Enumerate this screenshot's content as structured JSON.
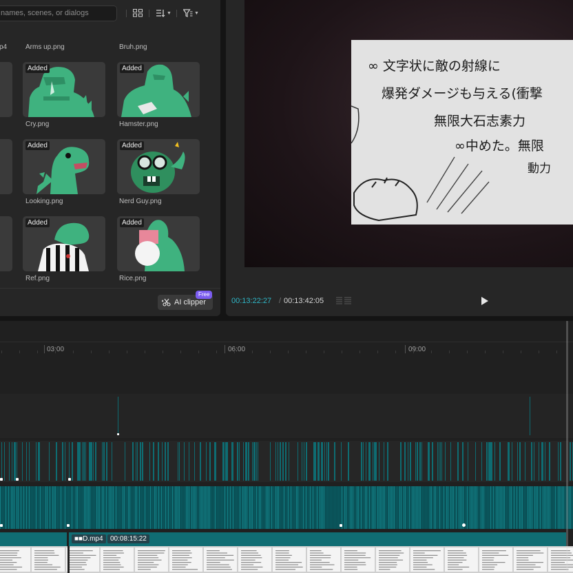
{
  "media": {
    "search_placeholder": "names, scenes, or dialogs",
    "added_label": "Added",
    "files": {
      "row0": [
        "p4",
        "Arms up.png",
        "Bruh.png"
      ],
      "row1": [
        "Cry.png",
        "Hamster.png"
      ],
      "row2": [
        "Looking.png",
        "Nerd Guy.png"
      ],
      "row3": [
        "Ref.png",
        "Rice.png"
      ]
    },
    "ai_clipper_label": "AI clipper",
    "free_label": "Free"
  },
  "player": {
    "current_time": "00:13:22:27",
    "separator": "/",
    "total_time": "00:13:42:05",
    "note_lines": [
      "∞ 文字状に敵の射線に",
      "爆発ダメージも与える(衝撃",
      "無限大石志素力",
      "∞中めた。無限",
      "動力"
    ]
  },
  "timeline": {
    "ruler_labels": [
      "03:00",
      "06:00",
      "09:00"
    ],
    "clip_name": "■■D.mp4",
    "clip_duration": "00:08:15:22"
  },
  "colors": {
    "accent_teal": "#2fb8c8",
    "track_teal": "#0e6c72",
    "free_badge": "#7b5cf0",
    "panel_bg": "#262626"
  },
  "icons": [
    "grid-view-icon",
    "sort-icon",
    "filter-icon",
    "scissors-sparkle-icon",
    "play-icon",
    "layout-icon"
  ]
}
